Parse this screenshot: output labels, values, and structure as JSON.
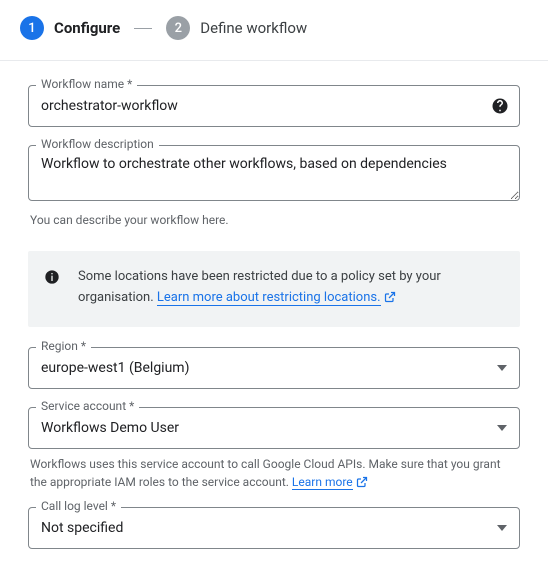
{
  "stepper": {
    "step1": {
      "num": "1",
      "label": "Configure"
    },
    "step2": {
      "num": "2",
      "label": "Define workflow"
    }
  },
  "fields": {
    "name": {
      "label": "Workflow name *",
      "value": "orchestrator-workflow"
    },
    "description": {
      "label": "Workflow description",
      "value": "Workflow to orchestrate other workflows, based on dependencies",
      "hint": "You can describe your workflow here."
    },
    "region": {
      "label": "Region *",
      "value": "europe-west1 (Belgium)"
    },
    "service_account": {
      "label": "Service account *",
      "value": "Workflows Demo User",
      "hint_prefix": "Workflows uses this service account to call Google Cloud APIs. Make sure that you grant the appropriate IAM roles to the service account. ",
      "hint_link": "Learn more"
    },
    "log_level": {
      "label": "Call log level *",
      "value": "Not specified"
    }
  },
  "banner": {
    "text_prefix": "Some locations have been restricted due to a policy set by your organisation. ",
    "link": "Learn more about restricting locations."
  }
}
